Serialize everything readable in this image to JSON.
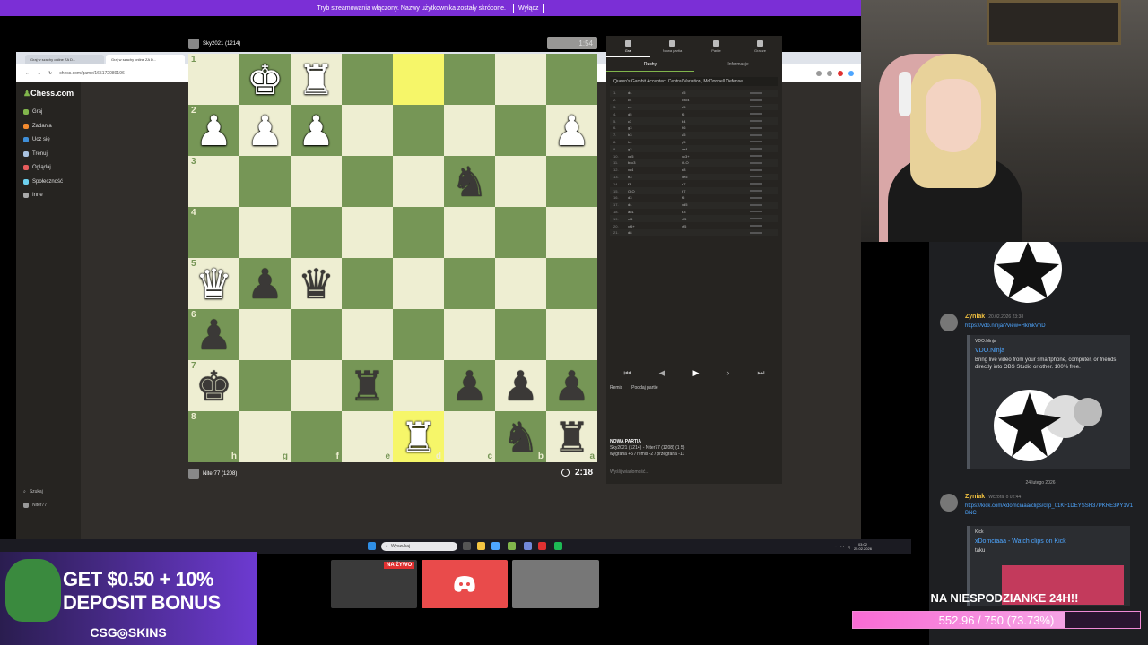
{
  "banner": {
    "text": "Tryb streamowania włączony. Nazwy użytkownika zostały skrócone.",
    "button": "Wyłącz"
  },
  "browser": {
    "tabs": [
      "Graj w szachy online ZA D...",
      "Graj w szachy online ZA D..."
    ],
    "url": "chess.com/game/165172080196"
  },
  "sidebar": {
    "logo": "Chess.com",
    "items": [
      {
        "label": "Graj",
        "color": "#81b64c"
      },
      {
        "label": "Zadania",
        "color": "#f28a2e"
      },
      {
        "label": "Ucz się",
        "color": "#3f8fd8"
      },
      {
        "label": "Trenuj",
        "color": "#a9c2e0"
      },
      {
        "label": "Oglądaj",
        "color": "#e85d5d"
      },
      {
        "label": "Społeczność",
        "color": "#6dd0ee"
      },
      {
        "label": "Inne",
        "color": "#aaaaaa"
      }
    ],
    "search": "Szukaj",
    "user": "Niter77"
  },
  "game": {
    "top_player": "Sky2021 (1214)",
    "top_clock": "1:54",
    "bottom_player": "Niter77 (1208)",
    "bottom_clock": "2:18",
    "ranks": [
      "1",
      "2",
      "3",
      "4",
      "5",
      "6",
      "7",
      "8"
    ],
    "files": [
      "h",
      "g",
      "f",
      "e",
      "d",
      "c",
      "b",
      "a"
    ],
    "board": [
      [
        "",
        "wK",
        "wR",
        "",
        "",
        "",
        "",
        ""
      ],
      [
        "wP",
        "wP",
        "wP",
        "",
        "",
        "",
        "",
        "wP"
      ],
      [
        "",
        "",
        "",
        "",
        "",
        "bN",
        "",
        ""
      ],
      [
        "",
        "",
        "",
        "",
        "",
        "",
        "",
        ""
      ],
      [
        "wQ",
        "bP",
        "bQ",
        "",
        "",
        "",
        "",
        ""
      ],
      [
        "bP",
        "",
        "",
        "",
        "",
        "",
        "",
        ""
      ],
      [
        "bK",
        "",
        "",
        "bR",
        "",
        "bP",
        "bP",
        "bP"
      ],
      [
        "",
        "",
        "",
        "",
        "wR",
        "",
        "bN",
        "bR"
      ]
    ],
    "highlights": [
      [
        0,
        4
      ],
      [
        7,
        4
      ]
    ]
  },
  "panel": {
    "tabs": [
      "Graj",
      "Nowa partia",
      "Partie",
      "Gracze"
    ],
    "sub_tabs": [
      "Ruchy",
      "Informacje"
    ],
    "opening": "Queen's Gambit Accepted: Central Variation, McDonnell Defense",
    "moves": [
      {
        "n": "1.",
        "w": "d4",
        "b": "d5"
      },
      {
        "n": "2.",
        "w": "c4",
        "b": "dxc4"
      },
      {
        "n": "3.",
        "w": "e4",
        "b": "e5"
      },
      {
        "n": "4.",
        "w": "d5",
        "b": "f6"
      },
      {
        "n": "5.",
        "w": "c3",
        "b": "b4"
      },
      {
        "n": "6.",
        "w": "g3",
        "b": "h6"
      },
      {
        "n": "7.",
        "w": "b3",
        "b": "a5"
      },
      {
        "n": "8.",
        "w": "h4",
        "b": "g5"
      },
      {
        "n": "9.",
        "w": "g3",
        "b": "xe4"
      },
      {
        "n": "10.",
        "w": "xe5",
        "b": "xc3+"
      },
      {
        "n": "11.",
        "w": "bxc3",
        "b": "O-O"
      },
      {
        "n": "12.",
        "w": "xc4",
        "b": "e8"
      },
      {
        "n": "13.",
        "w": "h3",
        "b": "xe5"
      },
      {
        "n": "14.",
        "w": "f3",
        "b": "e7"
      },
      {
        "n": "15.",
        "w": "O-O",
        "b": "h7"
      },
      {
        "n": "16.",
        "w": "d3",
        "b": "f5"
      },
      {
        "n": "17.",
        "w": "d4",
        "b": "xd5"
      },
      {
        "n": "18.",
        "w": "ad1",
        "b": "e3"
      },
      {
        "n": "19.",
        "w": "xf5",
        "b": "xf5"
      },
      {
        "n": "20.",
        "w": "xf5+",
        "b": "xf5"
      },
      {
        "n": "21.",
        "w": "d8",
        "b": ""
      }
    ],
    "actions": [
      "Remis",
      "Poddaj partię"
    ],
    "new_game_title": "NOWA PARTIA",
    "new_game_line": "Sky2021 (1214) - Niter77 (1208) (1 5)",
    "new_game_stats": "wygrana +5 / remis -2 / przegrana -11",
    "chat_placeholder": "Wyślij wiadomość..."
  },
  "taskbar": {
    "search": "Wyszukaj",
    "time": "03:02",
    "date": "25.02.2026"
  },
  "discord": {
    "msg1_name": "Zyniak",
    "msg1_time": "20.02.2026 23:38",
    "msg1_link": "https://vdo.ninja/?view=HkmkVhD",
    "embed1_provider": "VDO.Ninja",
    "embed1_title": "VDO.Ninja",
    "embed1_desc": "Bring live video from your smartphone, computer, or friends directly into OBS Studio or other. 100% free.",
    "date_divider": "24 lutego 2026",
    "msg2_name": "Zyniak",
    "msg2_time": "Wczoraj o 02:44",
    "msg2_link": "https://kick.com/xdomciaaa/clips/clip_01KF1DEYSSH37PKRE3PY1V1BNC",
    "embed2_provider": "Kick",
    "embed2_title": "xDomciaaa - Watch clips on Kick",
    "embed2_desc": "taku"
  },
  "ad": {
    "line1": "GET $0.50 + 10%",
    "line2": "DEPOSIT BONUS",
    "brand": "CSG◎SKINS"
  },
  "live_badge": "NA ŻYWO",
  "sub_goal": {
    "title": "NA NIESPODZIANKE 24H!!",
    "text": "552.96 / 750 (73.73%)",
    "fraction": 0.7373
  }
}
